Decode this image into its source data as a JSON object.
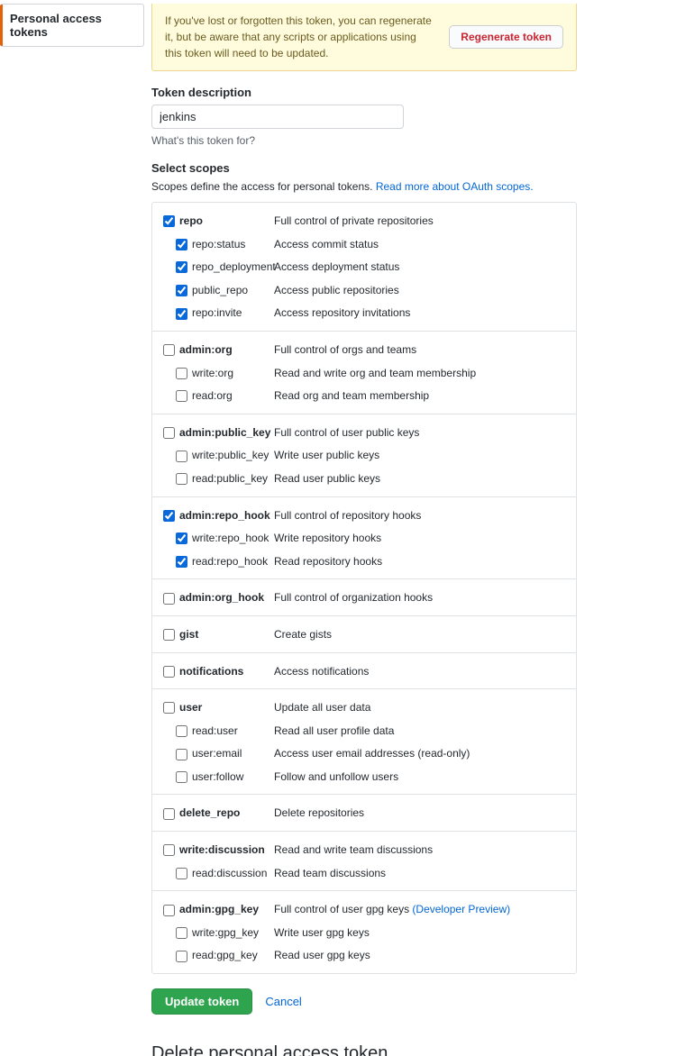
{
  "sidenav": {
    "item": "Personal access tokens"
  },
  "flash": {
    "text": "If you've lost or forgotten this token, you can regenerate it, but be aware that any scripts or applications using this token will need to be updated.",
    "regen": "Regenerate token"
  },
  "description": {
    "label": "Token description",
    "value": "jenkins",
    "help": "What's this token for?"
  },
  "scopes": {
    "heading": "Select scopes",
    "intro": "Scopes define the access for personal tokens. ",
    "link": "Read more about OAuth scopes.",
    "groups": [
      {
        "parent": {
          "name": "repo",
          "desc": "Full control of private repositories",
          "checked": true
        },
        "children": [
          {
            "name": "repo:status",
            "desc": "Access commit status",
            "checked": true
          },
          {
            "name": "repo_deployment",
            "desc": "Access deployment status",
            "checked": true
          },
          {
            "name": "public_repo",
            "desc": "Access public repositories",
            "checked": true
          },
          {
            "name": "repo:invite",
            "desc": "Access repository invitations",
            "checked": true
          }
        ]
      },
      {
        "parent": {
          "name": "admin:org",
          "desc": "Full control of orgs and teams",
          "checked": false
        },
        "children": [
          {
            "name": "write:org",
            "desc": "Read and write org and team membership",
            "checked": false
          },
          {
            "name": "read:org",
            "desc": "Read org and team membership",
            "checked": false
          }
        ]
      },
      {
        "parent": {
          "name": "admin:public_key",
          "desc": "Full control of user public keys",
          "checked": false
        },
        "children": [
          {
            "name": "write:public_key",
            "desc": "Write user public keys",
            "checked": false
          },
          {
            "name": "read:public_key",
            "desc": "Read user public keys",
            "checked": false
          }
        ]
      },
      {
        "parent": {
          "name": "admin:repo_hook",
          "desc": "Full control of repository hooks",
          "checked": true
        },
        "children": [
          {
            "name": "write:repo_hook",
            "desc": "Write repository hooks",
            "checked": true
          },
          {
            "name": "read:repo_hook",
            "desc": "Read repository hooks",
            "checked": true
          }
        ]
      },
      {
        "parent": {
          "name": "admin:org_hook",
          "desc": "Full control of organization hooks",
          "checked": false
        },
        "children": []
      },
      {
        "parent": {
          "name": "gist",
          "desc": "Create gists",
          "checked": false
        },
        "children": []
      },
      {
        "parent": {
          "name": "notifications",
          "desc": "Access notifications",
          "checked": false
        },
        "children": []
      },
      {
        "parent": {
          "name": "user",
          "desc": "Update all user data",
          "checked": false
        },
        "children": [
          {
            "name": "read:user",
            "desc": "Read all user profile data",
            "checked": false
          },
          {
            "name": "user:email",
            "desc": "Access user email addresses (read-only)",
            "checked": false
          },
          {
            "name": "user:follow",
            "desc": "Follow and unfollow users",
            "checked": false
          }
        ]
      },
      {
        "parent": {
          "name": "delete_repo",
          "desc": "Delete repositories",
          "checked": false
        },
        "children": []
      },
      {
        "parent": {
          "name": "write:discussion",
          "desc": "Read and write team discussions",
          "checked": false
        },
        "children": [
          {
            "name": "read:discussion",
            "desc": "Read team discussions",
            "checked": false
          }
        ]
      },
      {
        "parent": {
          "name": "admin:gpg_key",
          "desc": "Full control of user gpg keys ",
          "suffixLink": "(Developer Preview)",
          "checked": false
        },
        "children": [
          {
            "name": "write:gpg_key",
            "desc": "Write user gpg keys",
            "checked": false
          },
          {
            "name": "read:gpg_key",
            "desc": "Read user gpg keys",
            "checked": false
          }
        ]
      }
    ]
  },
  "actions": {
    "update": "Update token",
    "cancel": "Cancel"
  },
  "delete_heading": "Delete personal access token"
}
